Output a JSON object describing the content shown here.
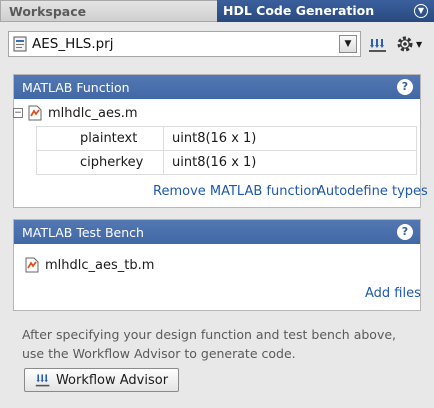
{
  "tabs": {
    "workspace": "Workspace",
    "hdl": "HDL Code Generation",
    "menu_icon": "chevron-down-circle-icon"
  },
  "project": {
    "name": "AES_HLS.prj",
    "icons": [
      "project-file-icon",
      "dropdown-arrow-icon",
      "workflow-advisor-icon",
      "gear-icon"
    ]
  },
  "matlab_function": {
    "header": "MATLAB Function",
    "help": "?",
    "file": "mlhdlc_aes.m",
    "collapse": "⊟",
    "inputs": [
      {
        "name": "plaintext",
        "type": "uint8(16 x 1)"
      },
      {
        "name": "cipherkey",
        "type": "uint8(16 x 1)"
      }
    ],
    "remove_link": "Remove MATLAB function",
    "autodefine_link": "Autodefine types"
  },
  "test_bench": {
    "header": "MATLAB Test Bench",
    "help": "?",
    "file": "mlhdlc_aes_tb.m",
    "add_link": "Add files"
  },
  "footer": {
    "text": "After specifying your design function and test bench above, use the Workflow Advisor to generate code.",
    "button": "Workflow Advisor"
  },
  "colors": {
    "header_blue": "#4168a6",
    "tab_active": "#284a80",
    "link": "#1d58b0"
  }
}
